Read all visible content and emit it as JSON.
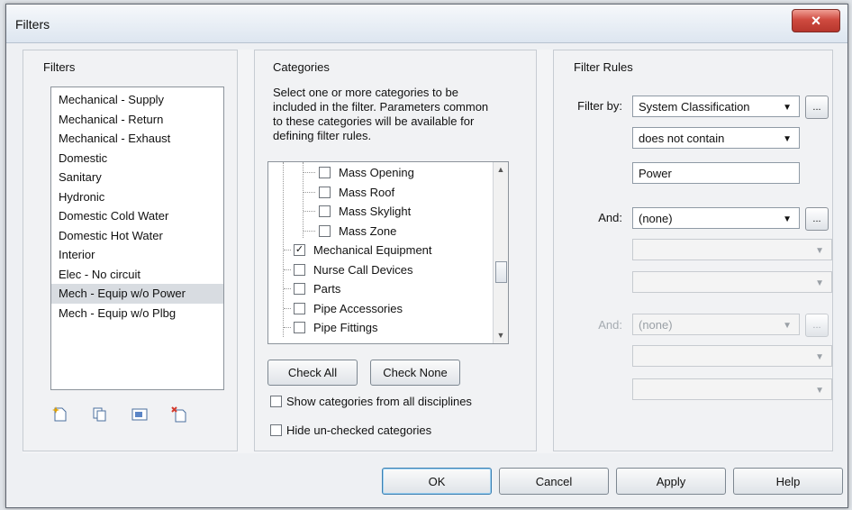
{
  "window": {
    "title": "Filters",
    "close_label": "×"
  },
  "filters_panel": {
    "label": "Filters",
    "items": [
      "Mechanical - Supply",
      "Mechanical - Return",
      "Mechanical - Exhaust",
      "Domestic",
      "Sanitary",
      "Hydronic",
      "Domestic Cold Water",
      "Domestic Hot Water",
      "Interior",
      "Elec - No circuit",
      "Mech - Equip w/o Power",
      "Mech - Equip w/o Plbg"
    ],
    "selected": "Mech - Equip w/o Power",
    "toolbar_icons": [
      "new-filter-icon",
      "duplicate-filter-icon",
      "rename-filter-icon",
      "delete-filter-icon"
    ]
  },
  "categories_panel": {
    "label": "Categories",
    "description": "Select one or more categories to be included in the filter. Parameters common to these categories will be available for defining filter rules.",
    "items": [
      {
        "label": "Mass Opening",
        "checked": false,
        "level": 2
      },
      {
        "label": "Mass Roof",
        "checked": false,
        "level": 2
      },
      {
        "label": "Mass Skylight",
        "checked": false,
        "level": 2
      },
      {
        "label": "Mass Zone",
        "checked": false,
        "level": 2
      },
      {
        "label": "Mechanical Equipment",
        "checked": true,
        "level": 1
      },
      {
        "label": "Nurse Call Devices",
        "checked": false,
        "level": 1
      },
      {
        "label": "Parts",
        "checked": false,
        "level": 1
      },
      {
        "label": "Pipe Accessories",
        "checked": false,
        "level": 1
      },
      {
        "label": "Pipe Fittings",
        "checked": false,
        "level": 1
      }
    ],
    "check_all": "Check All",
    "check_none": "Check None",
    "show_all_disciplines": "Show categories from all disciplines",
    "hide_unchecked": "Hide un-checked categories"
  },
  "rules_panel": {
    "label": "Filter Rules",
    "filter_by_label": "Filter by:",
    "filter_by_value": "System Classification",
    "operator_value": "does not contain",
    "text_value": "Power",
    "and1_label": "And:",
    "and1_value": "(none)",
    "and2_label": "And:",
    "and2_value": "(none)",
    "more_label": "..."
  },
  "footer": {
    "ok": "OK",
    "cancel": "Cancel",
    "apply": "Apply",
    "help": "Help"
  },
  "colors": {
    "accent": "#3c7fb1",
    "close_button": "#c4473d",
    "selected_row": "#d8dce1"
  }
}
